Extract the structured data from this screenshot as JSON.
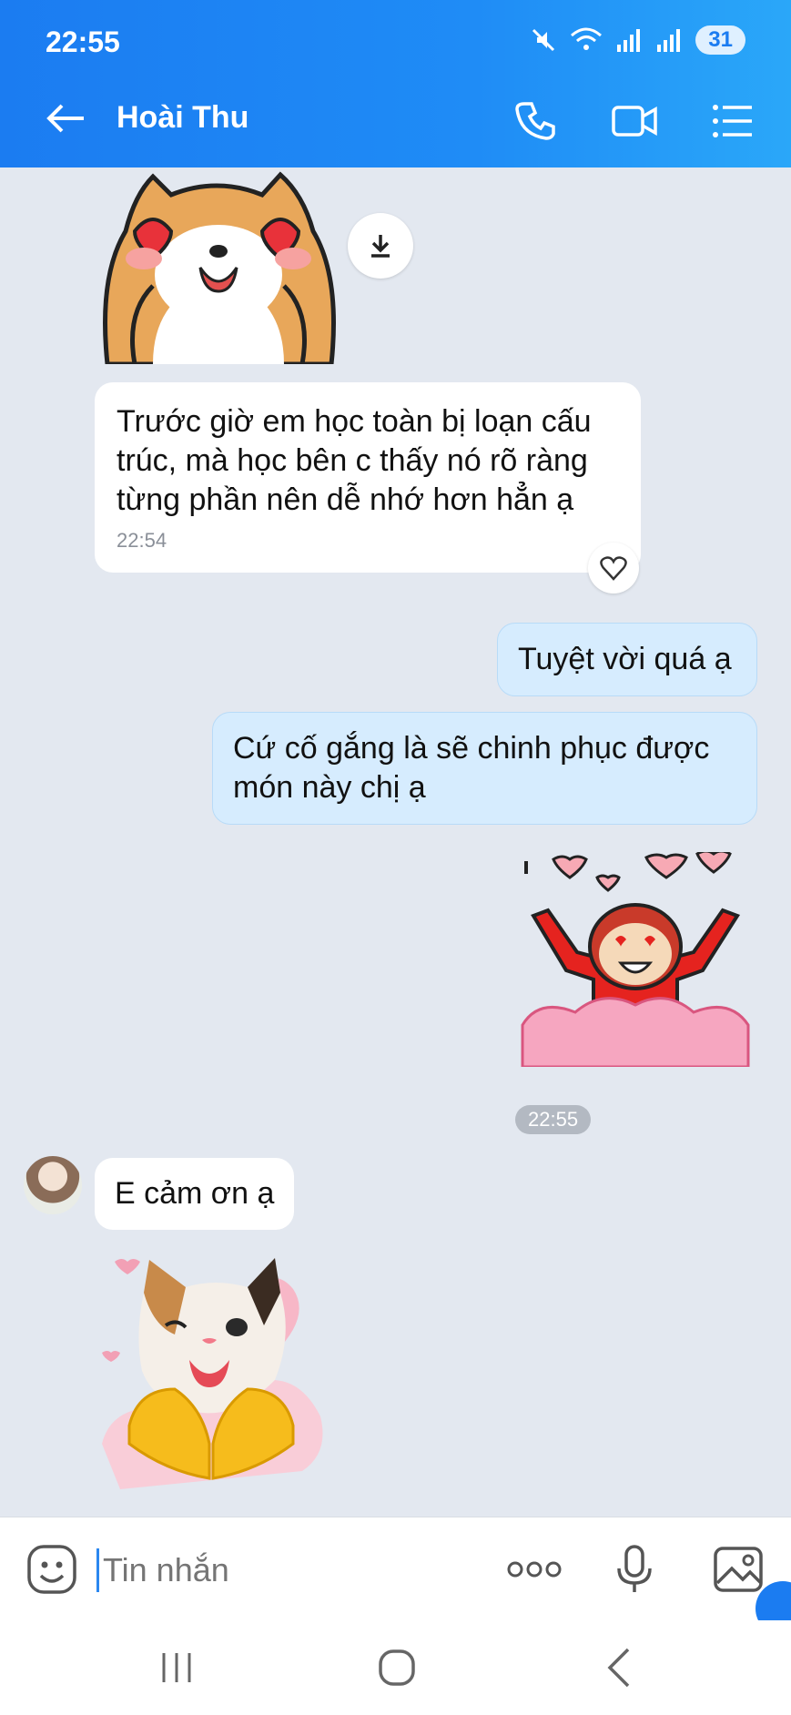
{
  "status_bar": {
    "time": "22:55",
    "battery": "31"
  },
  "header": {
    "contact_name": "Hoài Thu"
  },
  "messages": [
    {
      "text": "Trước giờ em học toàn bị loạn cấu trúc, mà học bên c thấy nó rõ ràng từng phần nên dễ nhớ hơn hẳn ạ",
      "time": "22:54"
    },
    {
      "text": "Tuyệt vời quá ạ"
    },
    {
      "text": "Cứ cố gắng là sẽ chinh phục được món này chị ạ"
    },
    {
      "time": "22:55"
    },
    {
      "text": "E cảm ơn ạ"
    }
  ],
  "input": {
    "placeholder": "Tin nhắn"
  },
  "colors": {
    "header": "#1f8cf6",
    "my_bubble": "#d6ecfe",
    "chat_bg": "#e3e8f0"
  }
}
